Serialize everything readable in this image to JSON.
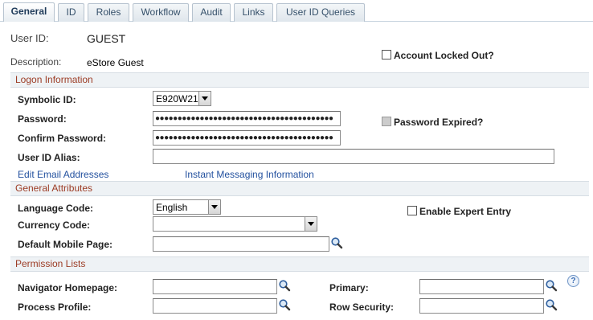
{
  "tabs": [
    {
      "label": "General",
      "active": true
    },
    {
      "label": "ID",
      "active": false
    },
    {
      "label": "Roles",
      "active": false
    },
    {
      "label": "Workflow",
      "active": false
    },
    {
      "label": "Audit",
      "active": false
    },
    {
      "label": "Links",
      "active": false
    },
    {
      "label": "User ID Queries",
      "active": false
    }
  ],
  "header": {
    "user_id_label": "User ID:",
    "user_id_value": "GUEST",
    "description_label": "Description:",
    "description_value": "eStore Guest",
    "account_locked_label": "Account Locked Out?",
    "account_locked_checked": false
  },
  "logon": {
    "section_title": "Logon Information",
    "symbolic_id_label": "Symbolic ID:",
    "symbolic_id_value": "E920W21",
    "password_label": "Password:",
    "password_value": "●●●●●●●●●●●●●●●●●●●●●●●●●●●●●●●●●●●●●●●●",
    "confirm_password_label": "Confirm Password:",
    "confirm_password_value": "●●●●●●●●●●●●●●●●●●●●●●●●●●●●●●●●●●●●●●●●",
    "password_expired_label": "Password Expired?",
    "password_expired_checked": false,
    "user_id_alias_label": "User ID Alias:",
    "user_id_alias_value": "",
    "edit_email_link": "Edit Email Addresses",
    "instant_messaging_link": "Instant Messaging Information"
  },
  "general_attributes": {
    "section_title": "General Attributes",
    "language_code_label": "Language Code:",
    "language_code_value": "English",
    "currency_code_label": "Currency Code:",
    "currency_code_value": "",
    "enable_expert_entry_label": "Enable Expert Entry",
    "enable_expert_entry_checked": false,
    "default_mobile_page_label": "Default Mobile Page:",
    "default_mobile_page_value": ""
  },
  "permission_lists": {
    "section_title": "Permission Lists",
    "navigator_homepage_label": "Navigator Homepage:",
    "navigator_homepage_value": "",
    "primary_label": "Primary:",
    "primary_value": "",
    "process_profile_label": "Process Profile:",
    "process_profile_value": "",
    "row_security_label": "Row Security:",
    "row_security_value": ""
  },
  "icons": {
    "lookup": "magnifier-lookup-icon",
    "help": "help-question-icon"
  }
}
